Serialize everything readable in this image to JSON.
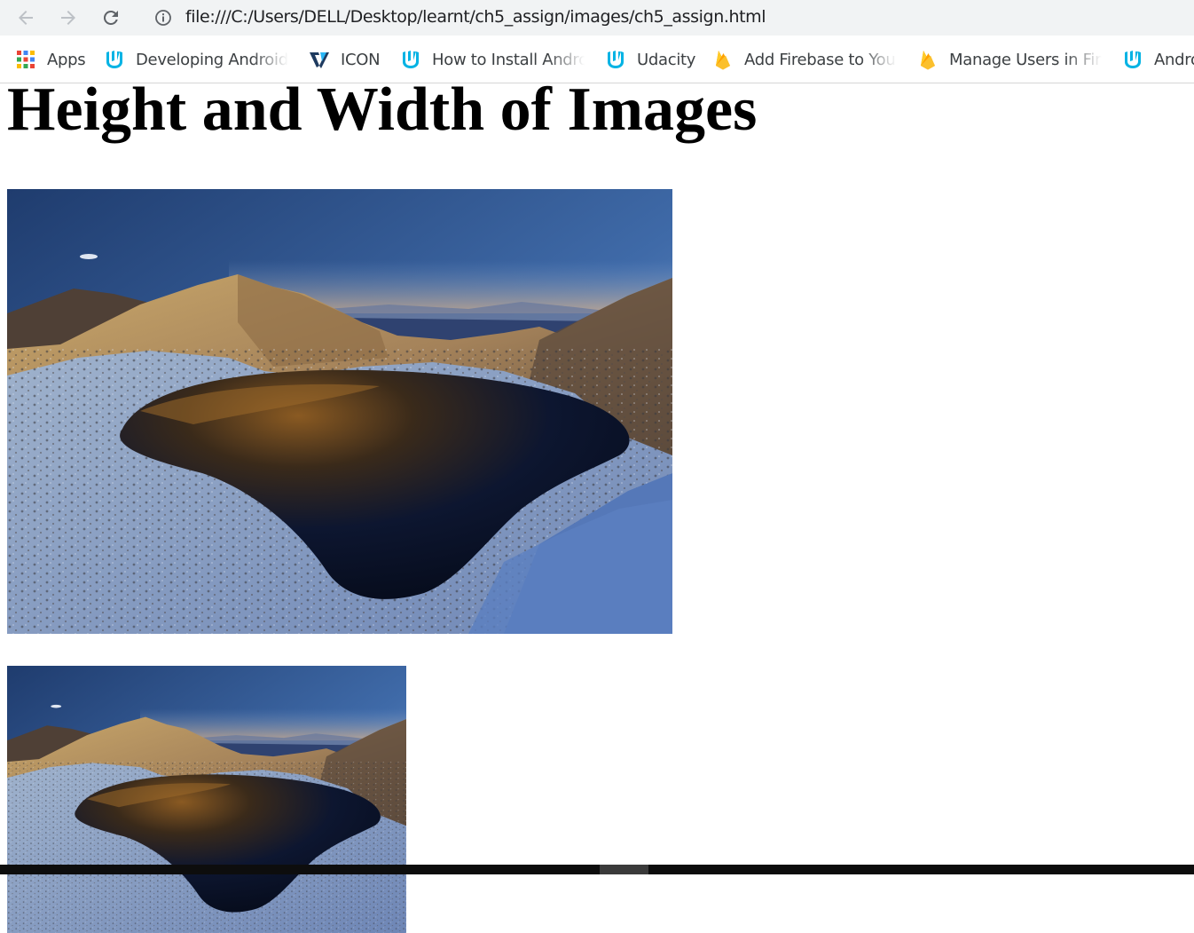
{
  "browser": {
    "url": "file:///C:/Users/DELL/Desktop/learnt/ch5_assign/images/ch5_assign.html",
    "bookmarks": [
      {
        "label": "Apps",
        "icon": "apps-grid-icon"
      },
      {
        "label": "Developing Android A",
        "icon": "udacity-icon"
      },
      {
        "label": "ICON",
        "icon": "vuetify-icon"
      },
      {
        "label": "How to Install Androi",
        "icon": "udacity-icon"
      },
      {
        "label": "Udacity",
        "icon": "udacity-icon"
      },
      {
        "label": "Add Firebase to Your",
        "icon": "firebase-icon"
      },
      {
        "label": "Manage Users in Fireb",
        "icon": "firebase-icon"
      },
      {
        "label": "Androi",
        "icon": "udacity-icon"
      }
    ]
  },
  "page": {
    "heading": "Height and Width of Images",
    "images": [
      {
        "description_icon": "mountain-lake-photo"
      },
      {
        "description_icon": "mountain-lake-photo"
      }
    ]
  },
  "colors": {
    "toolbar_bg": "#f1f3f4",
    "udacity_blue": "#02b3e4",
    "firebase_yellow": "#ffca28"
  }
}
